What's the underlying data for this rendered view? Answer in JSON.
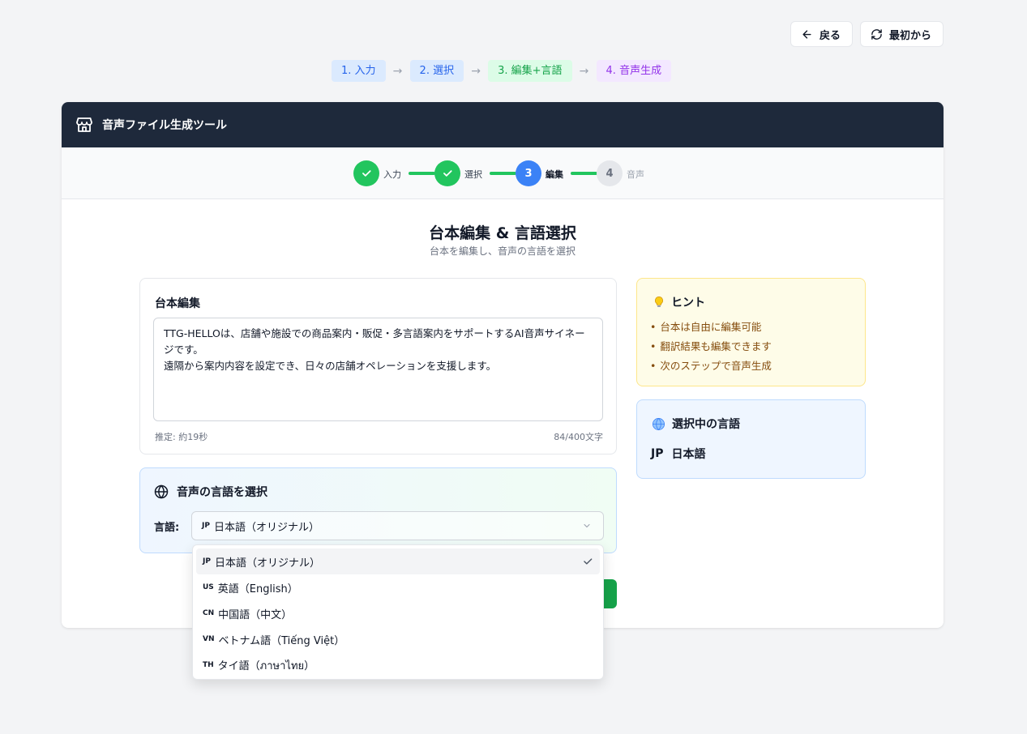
{
  "toolbar": {
    "back_label": "戻る",
    "restart_label": "最初から"
  },
  "breadcrumb": [
    "1. 入力",
    "2. 選択",
    "3. 編集+言語",
    "4. 音声生成"
  ],
  "breadcrumb_arrow": "→",
  "header": {
    "title": "音声ファイル生成ツール"
  },
  "stepper": {
    "steps": [
      {
        "label": "入力",
        "state": "done"
      },
      {
        "label": "選択",
        "state": "done"
      },
      {
        "label": "編集",
        "number": "3",
        "state": "current"
      },
      {
        "label": "音声",
        "number": "4",
        "state": "todo"
      }
    ]
  },
  "page": {
    "title": "台本編集 & 言語選択",
    "subtitle": "台本を編集し、音声の言語を選択"
  },
  "script_editor": {
    "title": "台本編集",
    "value": "TTG-HELLOは、店舗や施設での商品案内・販促・多言語案内をサポートするAI音声サイネージです。\n遠隔から案内内容を設定でき、日々の店舗オペレーションを支援します。",
    "estimate": "推定: 約19秒",
    "count": "84/400文字"
  },
  "language_select": {
    "title": "音声の言語を選択",
    "label": "言語:",
    "selected_flag": "JP",
    "selected_text": "日本語（オリジナル）",
    "options": [
      {
        "flag": "JP",
        "text": "日本語（オリジナル）",
        "selected": true
      },
      {
        "flag": "US",
        "text": "英語（English）"
      },
      {
        "flag": "CN",
        "text": "中国語（中文）"
      },
      {
        "flag": "VN",
        "text": "ベトナム語（Tiếng Việt）"
      },
      {
        "flag": "TH",
        "text": "タイ語（ภาษาไทย）"
      }
    ]
  },
  "hint": {
    "title": "ヒント",
    "items": [
      "台本は自由に編集可能",
      "翻訳結果も編集できます",
      "次のステップで音声生成"
    ]
  },
  "selected_language": {
    "title": "選択中の言語",
    "flag": "JP",
    "name": "日本語"
  },
  "colors": {
    "header_bg": "#1e293b",
    "done": "#22c55e",
    "current": "#3b82f6",
    "next_button": "#16a34a"
  }
}
